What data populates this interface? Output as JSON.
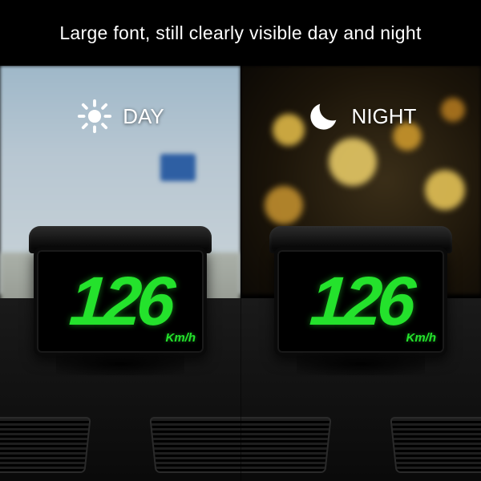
{
  "headline": "Large font, still clearly visible day and night",
  "day": {
    "label": "DAY",
    "speed": "126",
    "unit": "Km/h"
  },
  "night": {
    "label": "NIGHT",
    "speed": "126",
    "unit": "Km/h"
  }
}
